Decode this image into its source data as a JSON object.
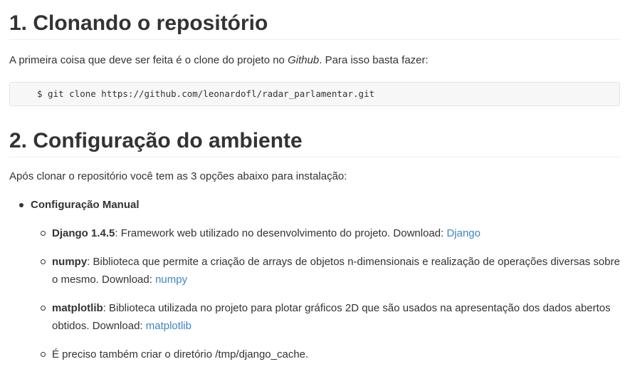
{
  "section1": {
    "heading": "1. Clonando o repositório",
    "intro_before": "A primeira coisa que deve ser feita é o clone do projeto no ",
    "intro_em": "Github",
    "intro_after": ". Para isso basta fazer:",
    "code": "$ git clone https://github.com/leonardofl/radar_parlamentar.git"
  },
  "section2": {
    "heading": "2. Configuração do ambiente",
    "intro": "Após clonar o repositório você tem as 3 opções abaixo para instalação:",
    "option1": {
      "title": "Configuração Manual",
      "items": [
        {
          "name": "Django 1.4.5",
          "desc": ": Framework web utilizado no desenvolvimento do projeto. Download: ",
          "link": "Django"
        },
        {
          "name": "numpy",
          "desc": ": Biblioteca que permite a criação de arrays de objetos n-dimensionais e realização de operações diversas sobre o mesmo. Download: ",
          "link": "numpy"
        },
        {
          "name": "matplotlib",
          "desc": ": Biblioteca utilizada no projeto para plotar gráficos 2D que são usados na apresentação dos dados abertos obtidos. Download: ",
          "link": "matplotlib"
        },
        {
          "text": "É preciso também criar o diretório /tmp/django_cache."
        }
      ]
    }
  }
}
